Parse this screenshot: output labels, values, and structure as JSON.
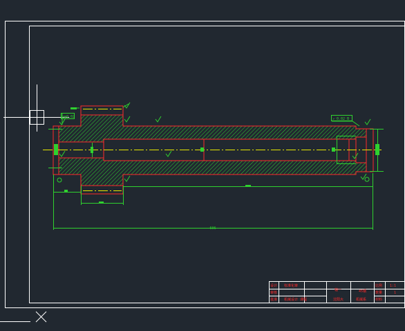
{
  "canvas": {
    "background": "#212830",
    "border_color": "#ffffff",
    "profile_color": "#ff2a2a",
    "hatch_color": "#2fd12f",
    "centerline_color": "#e8e800",
    "dimension_color": "#2fd12f"
  },
  "drawing": {
    "part": "stepped hollow shaft, longitudinal section",
    "hatch_pattern": "diagonal 45deg"
  },
  "annotations": {
    "geo_tolerance_left": "◎φ0.02",
    "geo_tolerance_right": "↗ 0.02 B",
    "dim_total_length": "606",
    "dim_bore": "",
    "dim_gear_width": "",
    "dim_small_left": "",
    "dim_right_dia": ""
  },
  "title_block": {
    "cells": [
      {
        "id": "r1c1",
        "text": "设计"
      },
      {
        "id": "r1c2",
        "text": "标准化审"
      },
      {
        "id": "r1c4",
        "text": "轴一"
      },
      {
        "id": "r1c5",
        "text": "45钢"
      },
      {
        "id": "r1c6",
        "text": "比例"
      },
      {
        "id": "r1c7",
        "text": "1:1"
      },
      {
        "id": "r2c1",
        "text": "审核"
      },
      {
        "id": "r2c6",
        "text": "数量"
      },
      {
        "id": "r2c7",
        "text": "1"
      },
      {
        "id": "r3c1",
        "text": "批准"
      },
      {
        "id": "r3c2",
        "text": "机械设计  课程"
      },
      {
        "id": "r3c4",
        "text": "沈阳大"
      },
      {
        "id": "r3c5",
        "text": "机械系"
      },
      {
        "id": "r3c6",
        "text": "材料"
      }
    ]
  }
}
